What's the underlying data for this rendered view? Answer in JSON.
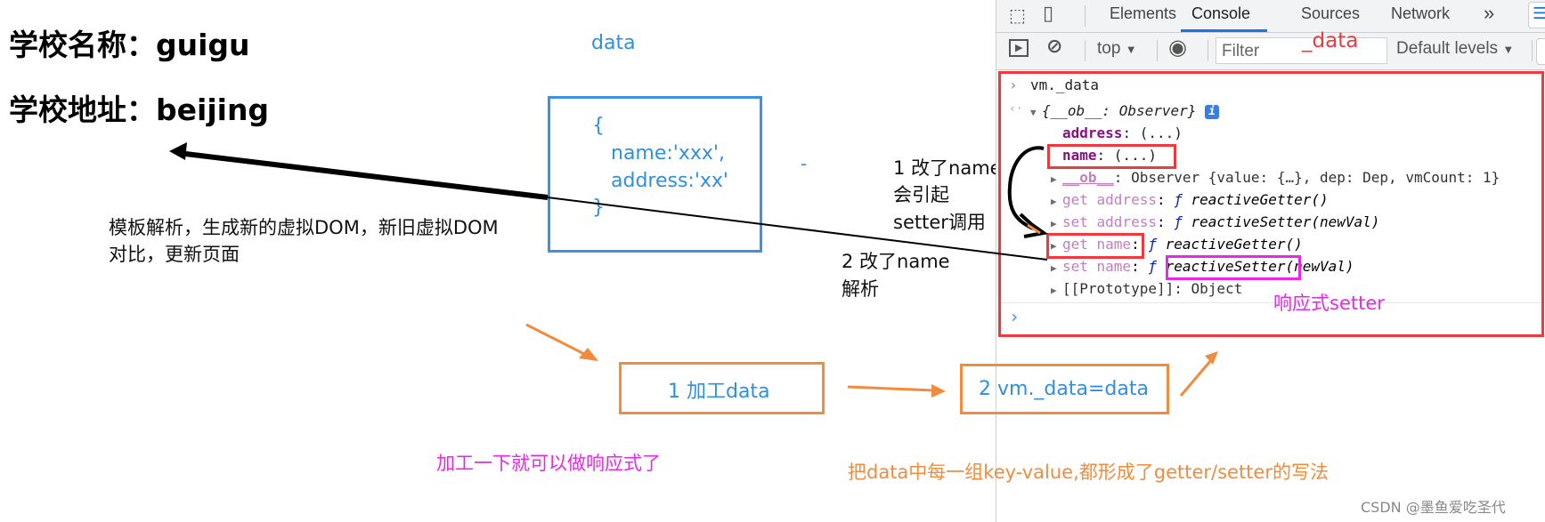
{
  "page": {
    "school_name": "学校名称：guigu",
    "school_address": "学校地址：beijing"
  },
  "annotations": {
    "data_label": "data",
    "data_object": {
      "open_brace": "{",
      "name_line": "name:'xxx',",
      "address_line": "address:'xx'",
      "close_brace": "}"
    },
    "dash_mark": "-",
    "template_note_line1": "模板解析，生成新的虚拟DOM，新旧虚拟DOM",
    "template_note_line2": "对比，更新页面",
    "step1_note_line1": "1 改了name",
    "step1_note_line2": "会引起",
    "step1_note_line3": "setter调用",
    "step2_note_line1": "2 改了name",
    "step2_note_line2": "解析",
    "filter_annotation": "_data",
    "reactive_setter_label": "响应式setter",
    "box1_label": "1 加工data",
    "box2_label": "2 vm._data=data",
    "pink_caption": "加工一下就可以做响应式了",
    "orange_caption": "把data中每一组key-value,都形成了getter/setter的写法",
    "watermark": "CSDN @墨鱼爱吃圣代"
  },
  "colors": {
    "blue_text": "#2f8fe0",
    "red_annotation": "#f2383c",
    "pink_annotation": "#e629e6",
    "orange_annotation": "#f28b3c",
    "devtools_tab_active_underline": "#1a73e8"
  },
  "devtools": {
    "tabs": [
      {
        "label": "Elements",
        "active": false
      },
      {
        "label": "Console",
        "active": true
      },
      {
        "label": "Sources",
        "active": false
      },
      {
        "label": "Network",
        "active": false
      }
    ],
    "more_tabs": "»",
    "toolbar": {
      "context": "top",
      "filter_placeholder": "Filter",
      "levels": "Default levels"
    },
    "console": {
      "input_command": "vm._data",
      "result_summary": "{__ob__: Observer}",
      "lines": [
        {
          "key": "address",
          "value": ": (...)"
        },
        {
          "key": "name",
          "value": ": (...)"
        },
        {
          "key": "__ob__",
          "value": ": Observer {value: {…}, dep: Dep, vmCount: 1}"
        },
        {
          "key": "get address",
          "sep": ": ",
          "f": "ƒ ",
          "fn": "reactiveGetter",
          "args": "()"
        },
        {
          "key": "set address",
          "sep": ": ",
          "f": "ƒ ",
          "fn": "reactiveSetter",
          "args": "(newVal)"
        },
        {
          "key": "get name",
          "sep": ": ",
          "f": "ƒ ",
          "fn": "reactiveGetter",
          "args": "()"
        },
        {
          "key": "set name",
          "sep": ": ",
          "f": "ƒ ",
          "fn": "reactiveSetter",
          "args": "(newVal)"
        },
        {
          "key": "[[Prototype]]",
          "value": ": Object"
        }
      ],
      "prompt": "›"
    }
  }
}
